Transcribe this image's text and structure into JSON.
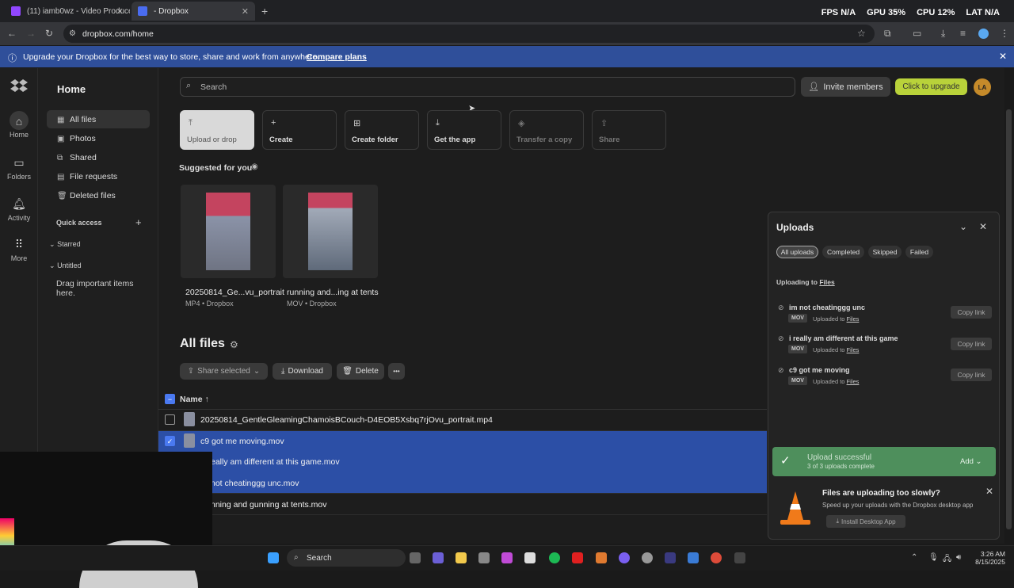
{
  "browser": {
    "tabs": [
      {
        "title": "(11) iamb0wz - Video Producer"
      },
      {
        "title": "- Dropbox"
      }
    ],
    "new_tab": "+",
    "url": "dropbox.com/home",
    "perf": {
      "fps_label": "FPS",
      "fps": "N/A",
      "gpu_label": "GPU",
      "gpu": "35%",
      "cpu_label": "CPU",
      "cpu": "12%",
      "lat_label": "LAT",
      "lat": "N/A"
    }
  },
  "banner": {
    "text": "Upgrade your Dropbox for the best way to store, share and work from anywhere.",
    "link": "Compare plans"
  },
  "rail": {
    "items": [
      {
        "label": "Home"
      },
      {
        "label": "Folders"
      },
      {
        "label": "Activity"
      },
      {
        "label": "More"
      }
    ]
  },
  "sidebar": {
    "title": "Home",
    "items": [
      {
        "label": "All files"
      },
      {
        "label": "Photos"
      },
      {
        "label": "Shared"
      },
      {
        "label": "File requests"
      },
      {
        "label": "Deleted files"
      }
    ],
    "quick_access": "Quick access",
    "quick_add": "+",
    "starred": "Starred",
    "untitled": "Untitled",
    "drag_hint": "Drag important items here."
  },
  "header": {
    "search_placeholder": "Search",
    "invite": "Invite members",
    "upgrade": "Click to upgrade",
    "avatar": "LA"
  },
  "actions": [
    {
      "label": "Upload or drop",
      "icon": "upload-icon"
    },
    {
      "label": "Create",
      "icon": "plus-icon"
    },
    {
      "label": "Create folder",
      "icon": "folder-plus-icon"
    },
    {
      "label": "Get the app",
      "icon": "download-icon"
    },
    {
      "label": "Transfer a copy",
      "icon": "transfer-icon"
    },
    {
      "label": "Share",
      "icon": "share-icon"
    }
  ],
  "suggested": {
    "title": "Suggested for you",
    "items": [
      {
        "name": "20250814_Ge...vu_portrait",
        "meta": "MP4 • Dropbox"
      },
      {
        "name": "running and...ing at tents",
        "meta": "MOV • Dropbox"
      }
    ]
  },
  "files": {
    "title": "All files",
    "toolbar": {
      "share": "Share selected",
      "download": "Download",
      "delete": "Delete",
      "more": "•••"
    },
    "column_name": "Name",
    "rows": [
      {
        "name": "20250814_GentleGleamingChamoisBCouch-D4EOB5Xsbq7rjOvu_portrait.mp4",
        "selected": false
      },
      {
        "name": "c9 got me moving.mov",
        "selected": true
      },
      {
        "name": "eally am different at this game.mov",
        "selected": true
      },
      {
        "name": "not cheatinggg unc.mov",
        "selected": true
      },
      {
        "name": "nning and gunning at tents.mov",
        "selected": false
      }
    ]
  },
  "uploads": {
    "title": "Uploads",
    "filters": [
      "All uploads",
      "Completed",
      "Skipped",
      "Failed"
    ],
    "uploading_to": "Uploading to",
    "uploading_dest": "Files",
    "items": [
      {
        "name": "im not cheatinggg unc",
        "type": "MOV",
        "dest_prefix": "Uploaded to",
        "dest": "Files",
        "action": "Copy link"
      },
      {
        "name": "i really am different at this game",
        "type": "MOV",
        "dest_prefix": "Uploaded to",
        "dest": "Files",
        "action": "Copy link"
      },
      {
        "name": "c9 got me moving",
        "type": "MOV",
        "dest_prefix": "Uploaded to",
        "dest": "Files",
        "action": "Copy link"
      }
    ],
    "success": {
      "title": "Upload successful",
      "sub": "3 of 3 uploads complete",
      "add": "Add"
    },
    "slow": {
      "title": "Files are uploading too slowly?",
      "sub": "Speed up your uploads with the Dropbox desktop app",
      "button": "Install Desktop App"
    }
  },
  "taskbar": {
    "search": "Search",
    "time": "3:26 AM",
    "date": "8/15/2025"
  }
}
